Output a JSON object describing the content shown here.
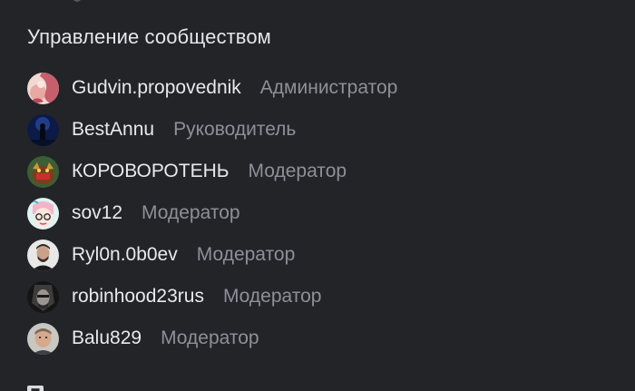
{
  "section": {
    "title": "Управление сообществом"
  },
  "members": [
    {
      "name": "Gudvin.propovednik",
      "role": "Администратор",
      "avatar_icon": "avatar-gudvin"
    },
    {
      "name": "BestAnnu",
      "role": "Руководитель",
      "avatar_icon": "avatar-bestannu"
    },
    {
      "name": "КОРОВОРОТЕНЬ",
      "role": "Модератор",
      "avatar_icon": "avatar-korovoroten"
    },
    {
      "name": "sov12",
      "role": "Модератор",
      "avatar_icon": "avatar-sov12"
    },
    {
      "name": "Ryl0n.0b0ev",
      "role": "Модератор",
      "avatar_icon": "avatar-ryl0n"
    },
    {
      "name": "robinhood23rus",
      "role": "Модератор",
      "avatar_icon": "avatar-robinhood"
    },
    {
      "name": "Balu829",
      "role": "Модератор",
      "avatar_icon": "avatar-balu"
    }
  ],
  "colors": {
    "background": "#222428",
    "name_text": "#e7e9ec",
    "role_text": "#8d9096"
  }
}
